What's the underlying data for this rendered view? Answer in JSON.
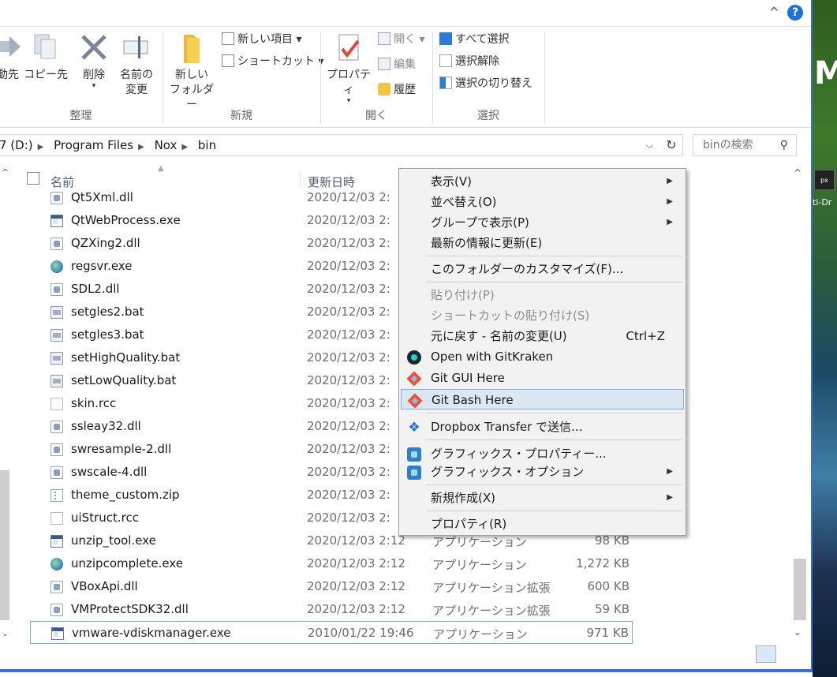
{
  "desktop": {
    "label": "ti-Dr"
  },
  "topbar": {
    "collapse_glyph": "^",
    "help_glyph": "?"
  },
  "ribbon": {
    "organize": {
      "label": "整理",
      "move_to": "動先",
      "copy_to": "コピー先",
      "delete": "削除",
      "rename_line1": "名前の",
      "rename_line2": "変更"
    },
    "new": {
      "label": "新規",
      "new_folder_line1": "新しい",
      "new_folder_line2": "フォルダー",
      "new_item": "新しい項目 ▾",
      "shortcut": "ショートカット ▾"
    },
    "open": {
      "label": "開く",
      "properties": "プロパティ",
      "open_btn": "開く ▾",
      "edit": "編集",
      "history": "履歴"
    },
    "select": {
      "label": "選択",
      "select_all": "すべて選択",
      "select_none": "選択解除",
      "invert": "選択の切り替え"
    }
  },
  "address": {
    "crumbs": [
      "7 (D:)",
      "Program Files",
      "Nox",
      "bin"
    ],
    "search_placeholder": "binの検索"
  },
  "columns": {
    "name": "名前",
    "date": "更新日時"
  },
  "files": [
    {
      "name": "Qt5Xml.dll",
      "date": "2020/12/03 2:",
      "type": "",
      "size": "",
      "icon": "dll"
    },
    {
      "name": "QtWebProcess.exe",
      "date": "2020/12/03 2:",
      "type": "",
      "size": "",
      "icon": "exe"
    },
    {
      "name": "QZXing2.dll",
      "date": "2020/12/03 2:",
      "type": "",
      "size": "",
      "icon": "dll"
    },
    {
      "name": "regsvr.exe",
      "date": "2020/12/03 2:",
      "type": "",
      "size": "",
      "icon": "setup"
    },
    {
      "name": "SDL2.dll",
      "date": "2020/12/03 2:",
      "type": "",
      "size": "",
      "icon": "dll"
    },
    {
      "name": "setgles2.bat",
      "date": "2020/12/03 2:",
      "type": "",
      "size": "",
      "icon": "bat"
    },
    {
      "name": "setgles3.bat",
      "date": "2020/12/03 2:",
      "type": "",
      "size": "",
      "icon": "bat"
    },
    {
      "name": "setHighQuality.bat",
      "date": "2020/12/03 2:",
      "type": "",
      "size": "",
      "icon": "bat"
    },
    {
      "name": "setLowQuality.bat",
      "date": "2020/12/03 2:",
      "type": "",
      "size": "",
      "icon": "bat"
    },
    {
      "name": "skin.rcc",
      "date": "2020/12/03 2:",
      "type": "",
      "size": "",
      "icon": "rcc"
    },
    {
      "name": "ssleay32.dll",
      "date": "2020/12/03 2:",
      "type": "",
      "size": "",
      "icon": "dll"
    },
    {
      "name": "swresample-2.dll",
      "date": "2020/12/03 2:",
      "type": "",
      "size": "",
      "icon": "dll"
    },
    {
      "name": "swscale-4.dll",
      "date": "2020/12/03 2:",
      "type": "",
      "size": "",
      "icon": "dll"
    },
    {
      "name": "theme_custom.zip",
      "date": "2020/12/03 2:",
      "type": "",
      "size": "",
      "icon": "zip"
    },
    {
      "name": "uiStruct.rcc",
      "date": "2020/12/03 2:",
      "type": "",
      "size": "",
      "icon": "rcc"
    },
    {
      "name": "unzip_tool.exe",
      "date": "2020/12/03 2:12",
      "type": "アプリケーション",
      "size": "98 KB",
      "icon": "exe"
    },
    {
      "name": "unzipcomplete.exe",
      "date": "2020/12/03 2:12",
      "type": "アプリケーション",
      "size": "1,272 KB",
      "icon": "setup"
    },
    {
      "name": "VBoxApi.dll",
      "date": "2020/12/03 2:12",
      "type": "アプリケーション拡張",
      "size": "600 KB",
      "icon": "dll"
    },
    {
      "name": "VMProtectSDK32.dll",
      "date": "2020/12/03 2:12",
      "type": "アプリケーション拡張",
      "size": "59 KB",
      "icon": "dll"
    },
    {
      "name": "vmware-vdiskmanager.exe",
      "date": "2010/01/22 19:46",
      "type": "アプリケーション",
      "size": "971 KB",
      "icon": "exe"
    }
  ],
  "context_menu": {
    "view": "表示(V)",
    "sort": "並べ替え(O)",
    "group": "グループで表示(P)",
    "refresh": "最新の情報に更新(E)",
    "customize": "このフォルダーのカスタマイズ(F)...",
    "paste": "貼り付け(P)",
    "paste_shortcut": "ショートカットの貼り付け(S)",
    "undo": "元に戻す - 名前の変更(U)",
    "undo_shortcut": "Ctrl+Z",
    "gitkraken": "Open with GitKraken",
    "git_gui": "Git GUI Here",
    "git_bash": "Git Bash Here",
    "dropbox": "Dropbox Transfer で送信...",
    "gfx_props": "グラフィックス・プロパティー...",
    "gfx_opts": "グラフィックス・オプション",
    "new": "新規作成(X)",
    "properties": "プロパティ(R)"
  }
}
